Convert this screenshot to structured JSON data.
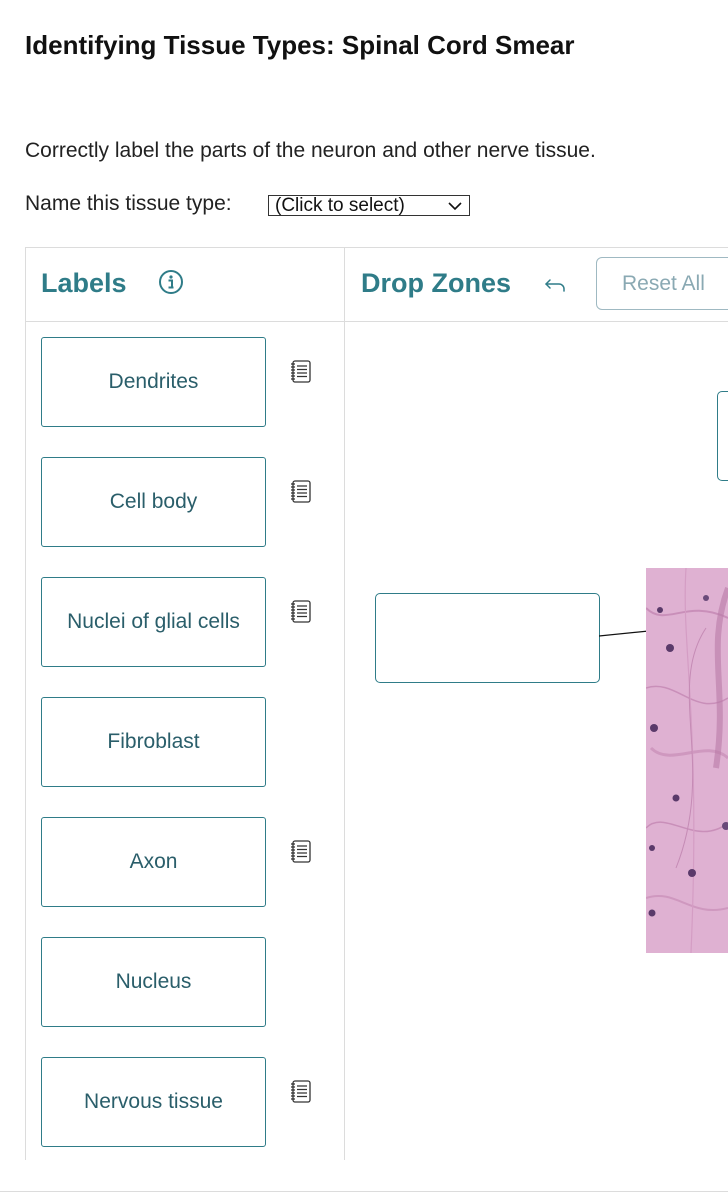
{
  "page": {
    "title": "Identifying Tissue Types: Spinal Cord Smear",
    "instructions": "Correctly label the parts of the neuron and other nerve tissue.",
    "tissue_prompt": "Name this tissue type:",
    "tissue_select": {
      "value": "(Click to select)"
    }
  },
  "labels_panel": {
    "heading": "Labels",
    "info_icon": "info-icon",
    "items": [
      {
        "label": "Dendrites",
        "has_notes": true
      },
      {
        "label": "Cell body",
        "has_notes": true
      },
      {
        "label": "Nuclei of glial cells",
        "has_notes": true
      },
      {
        "label": "Fibroblast",
        "has_notes": false
      },
      {
        "label": "Axon",
        "has_notes": true
      },
      {
        "label": "Nucleus",
        "has_notes": false
      },
      {
        "label": "Nervous tissue",
        "has_notes": true
      }
    ]
  },
  "drop_zones_panel": {
    "heading": "Drop Zones",
    "undo_icon": "undo-icon",
    "reset_label": "Reset All"
  },
  "colors": {
    "accent": "#2f7c88",
    "label_text": "#2a5e6a",
    "tissue_pink": "#d9a6cc"
  }
}
